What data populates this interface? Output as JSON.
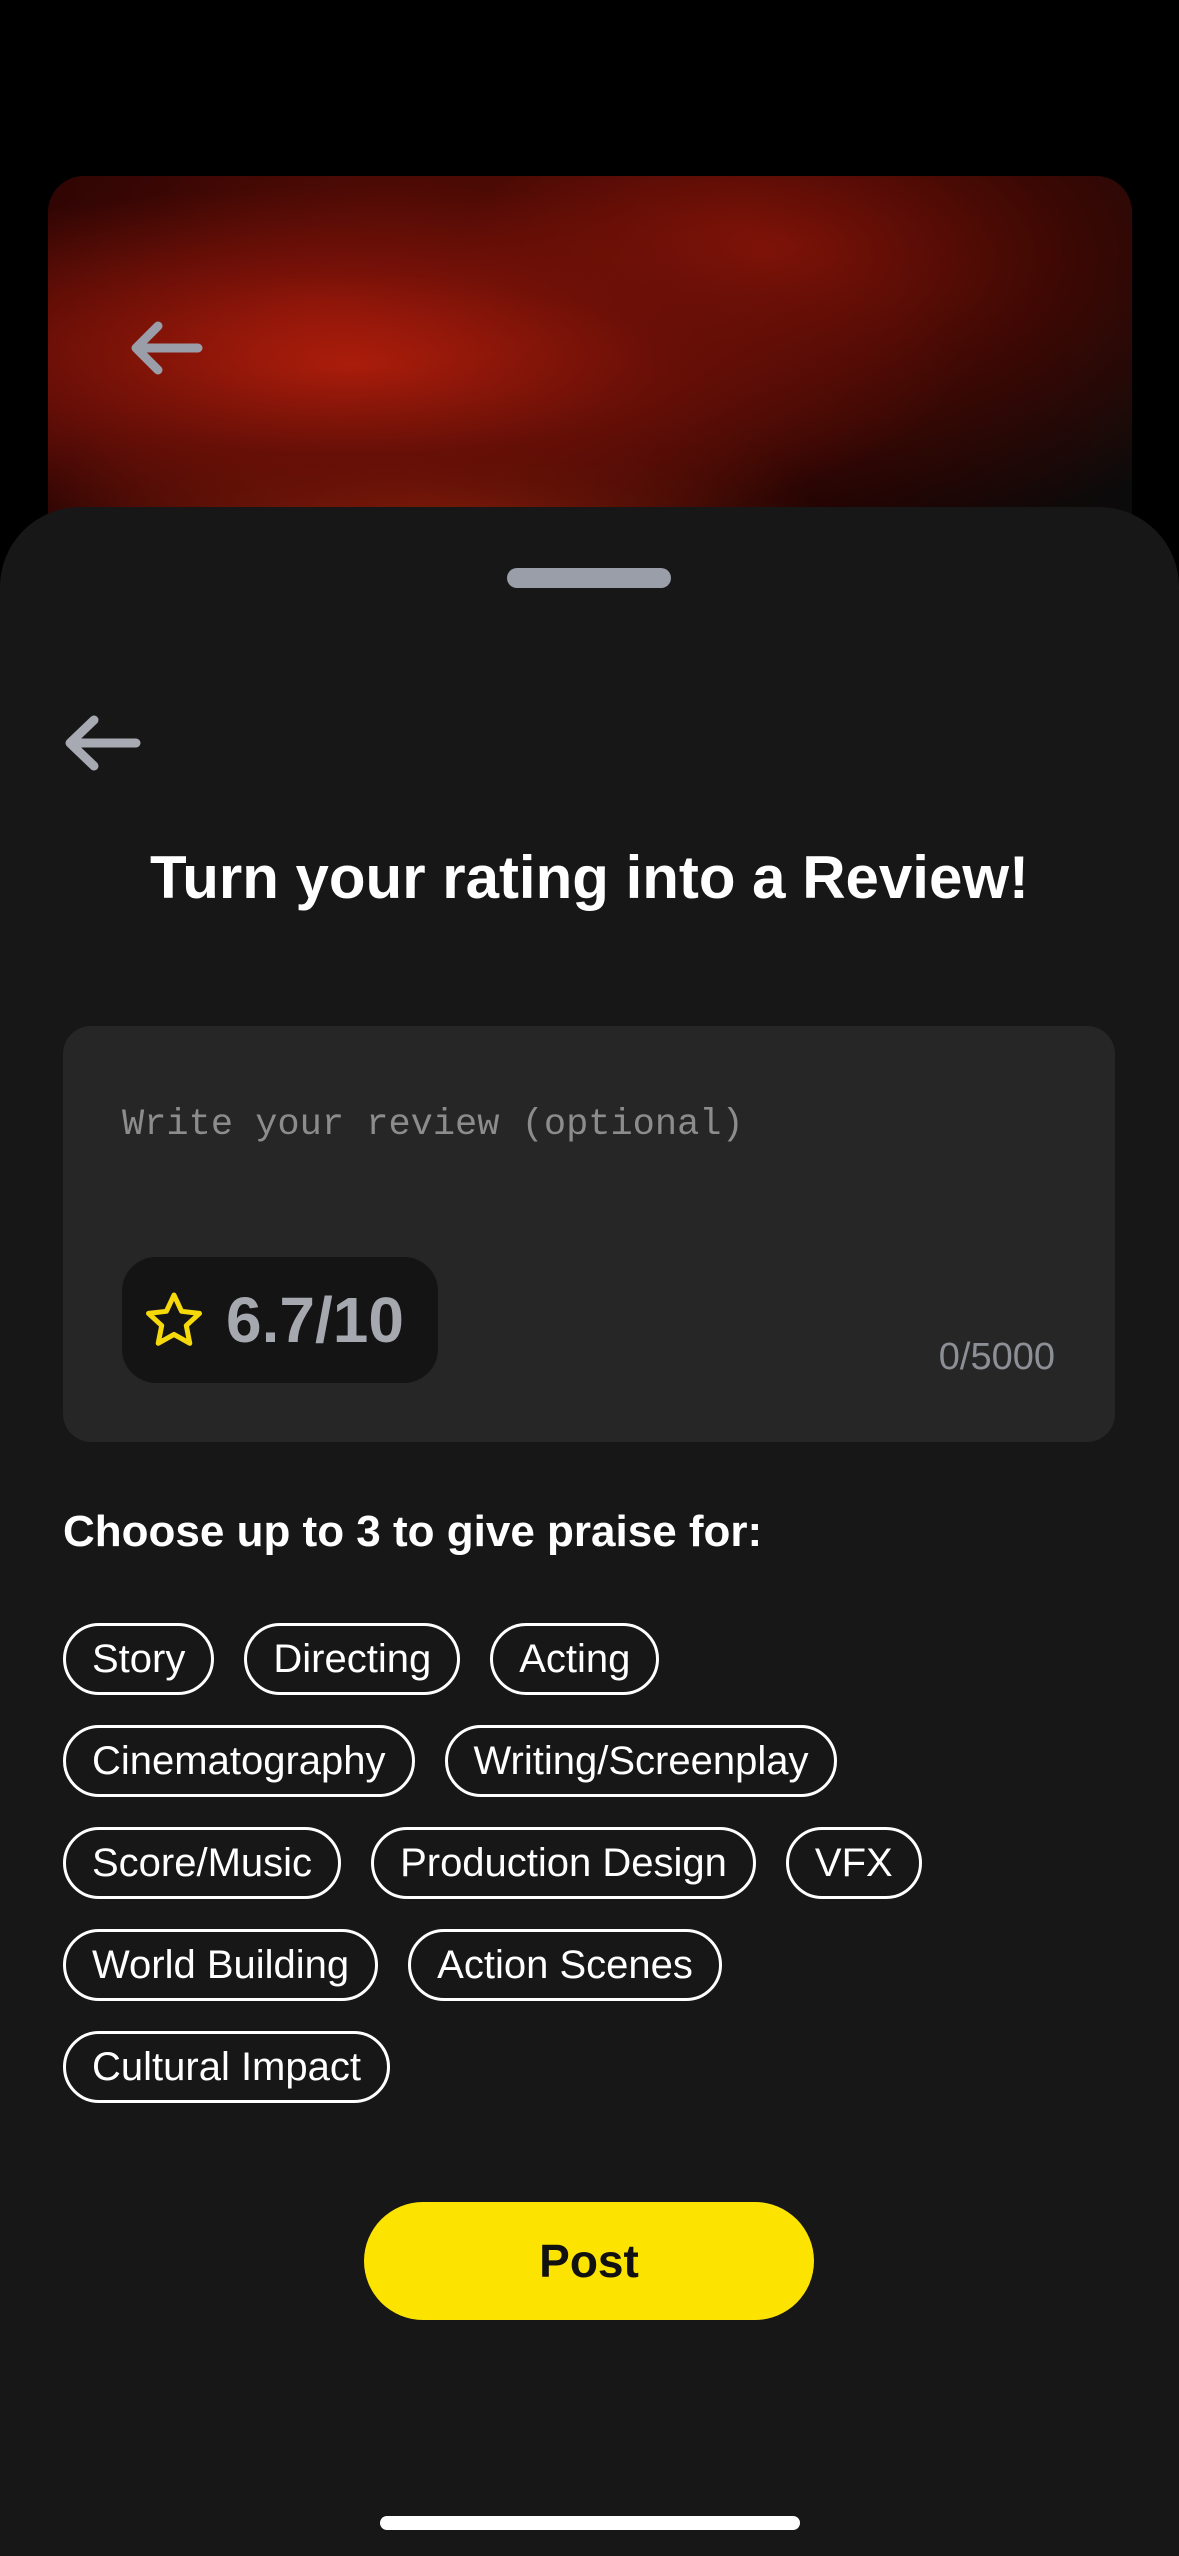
{
  "header": {
    "backdrop_image": "movie-poster-red-monster",
    "back_icon": "arrow-left-icon"
  },
  "sheet": {
    "back_icon": "arrow-left-icon",
    "title": "Turn your rating into a Review!"
  },
  "review": {
    "placeholder": "Write your review (optional)",
    "value": "",
    "rating_icon": "star-outline-icon",
    "rating": "6.7/10",
    "char_count": "0/5000"
  },
  "praise": {
    "heading": "Choose up to 3 to give praise for:",
    "rows": [
      [
        "Story",
        "Directing",
        "Acting"
      ],
      [
        "Cinematography",
        "Writing/Screenplay"
      ],
      [
        "Score/Music",
        "Production Design",
        "VFX"
      ],
      [
        "World Building",
        "Action Scenes"
      ],
      [
        "Cultural Impact"
      ]
    ]
  },
  "post_button": "Post",
  "colors": {
    "accent": "#fde300",
    "sheet_bg": "#171717",
    "input_bg": "#262626",
    "star": "#f5d90a"
  }
}
